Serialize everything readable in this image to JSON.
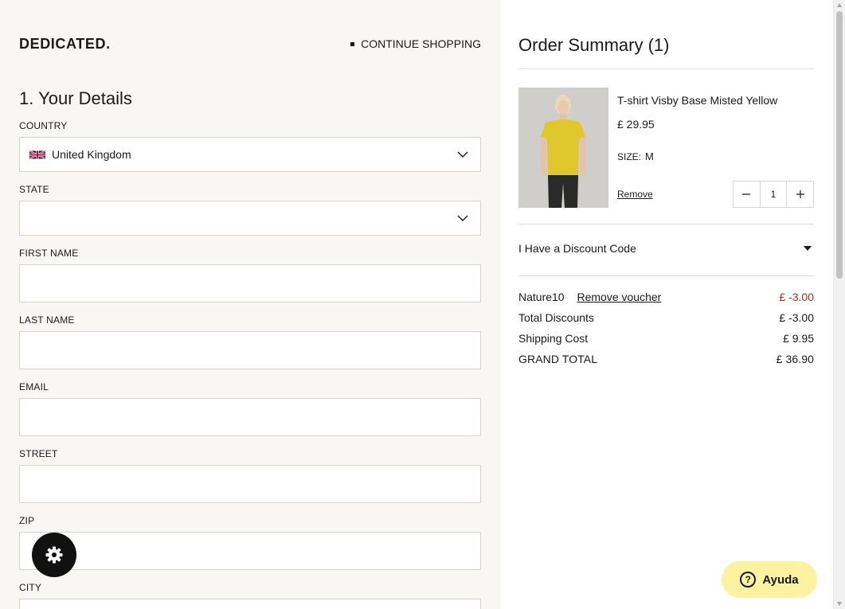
{
  "header": {
    "logo": "DEDICATED.",
    "continue_label": "CONTINUE SHOPPING"
  },
  "details": {
    "title": "1. Your Details",
    "fields": {
      "country": {
        "label": "COUNTRY",
        "value": "United Kingdom"
      },
      "state": {
        "label": "STATE",
        "value": ""
      },
      "first_name": {
        "label": "FIRST NAME",
        "value": ""
      },
      "last_name": {
        "label": "LAST NAME",
        "value": ""
      },
      "email": {
        "label": "EMAIL",
        "value": ""
      },
      "street": {
        "label": "STREET",
        "value": ""
      },
      "zip": {
        "label": "ZIP",
        "value": ""
      },
      "city": {
        "label": "CITY",
        "value": ""
      }
    }
  },
  "summary": {
    "title": "Order Summary (1)",
    "item": {
      "name": "T-shirt Visby Base Misted Yellow",
      "price": "£ 29.95",
      "size_label": "SIZE:",
      "size_value": "M",
      "remove_label": "Remove",
      "quantity": "1",
      "image_color": "#e1c72e"
    },
    "discount_label": "I Have a Discount Code",
    "voucher": {
      "code": "Nature10",
      "remove_label": "Remove voucher",
      "amount": "£ -3.00"
    },
    "total_discounts": {
      "label": "Total Discounts",
      "value": "£ -3.00"
    },
    "shipping": {
      "label": "Shipping Cost",
      "value": "£ 9.95"
    },
    "grand_total": {
      "label": "GRAND TOTAL",
      "value": "£ 36.90"
    }
  },
  "help": {
    "label": "Ayuda"
  },
  "colors": {
    "left_bg": "#f8f7f3",
    "accent_red": "#b02d16",
    "help_bg": "#fdf2a0"
  },
  "icons": [
    "uk-flag-icon",
    "chevron-down-icon",
    "gear-icon",
    "minus-icon",
    "plus-icon",
    "caret-down-icon",
    "help-icon"
  ]
}
